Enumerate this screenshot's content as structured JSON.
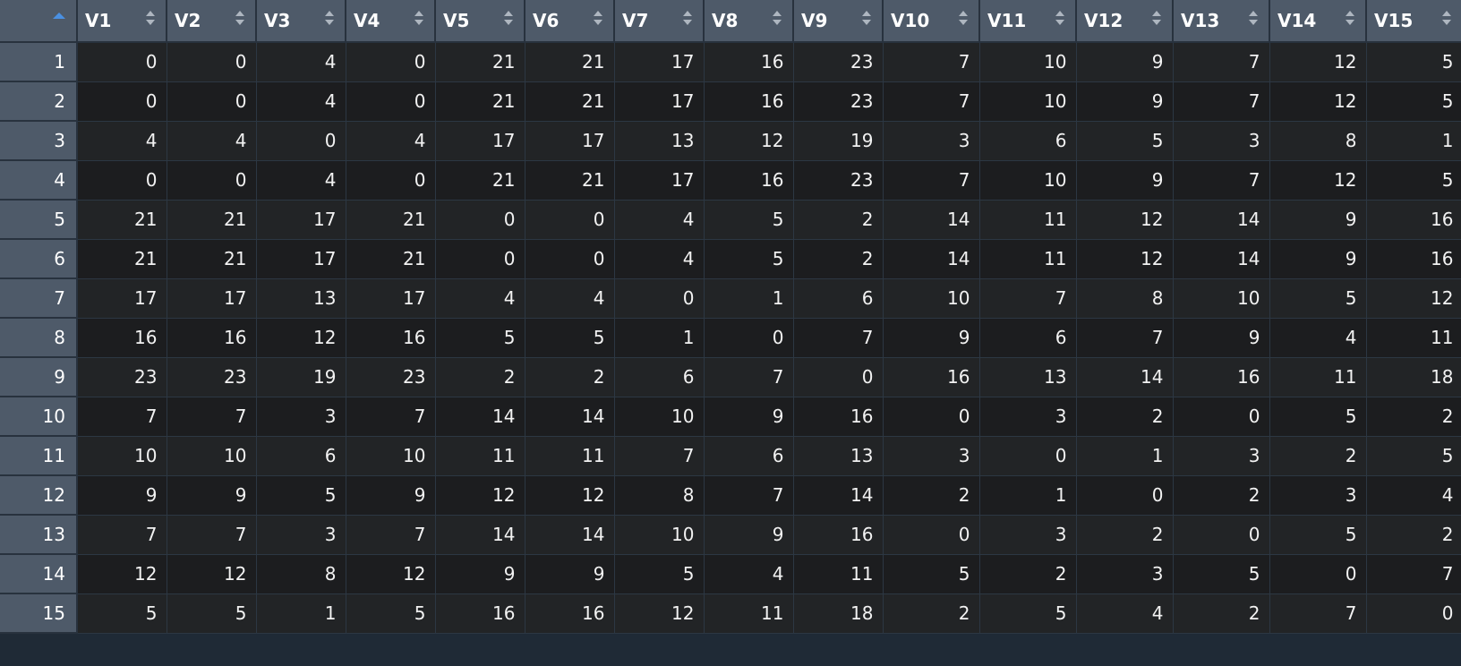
{
  "table": {
    "corner_label": "",
    "columns": [
      "V1",
      "V2",
      "V3",
      "V4",
      "V5",
      "V6",
      "V7",
      "V8",
      "V9",
      "V10",
      "V11",
      "V12",
      "V13",
      "V14",
      "V15"
    ],
    "row_names": [
      "1",
      "2",
      "3",
      "4",
      "5",
      "6",
      "7",
      "8",
      "9",
      "10",
      "11",
      "12",
      "13",
      "14",
      "15"
    ],
    "rows": [
      [
        0,
        0,
        4,
        0,
        21,
        21,
        17,
        16,
        23,
        7,
        10,
        9,
        7,
        12,
        5
      ],
      [
        0,
        0,
        4,
        0,
        21,
        21,
        17,
        16,
        23,
        7,
        10,
        9,
        7,
        12,
        5
      ],
      [
        4,
        4,
        0,
        4,
        17,
        17,
        13,
        12,
        19,
        3,
        6,
        5,
        3,
        8,
        1
      ],
      [
        0,
        0,
        4,
        0,
        21,
        21,
        17,
        16,
        23,
        7,
        10,
        9,
        7,
        12,
        5
      ],
      [
        21,
        21,
        17,
        21,
        0,
        0,
        4,
        5,
        2,
        14,
        11,
        12,
        14,
        9,
        16
      ],
      [
        21,
        21,
        17,
        21,
        0,
        0,
        4,
        5,
        2,
        14,
        11,
        12,
        14,
        9,
        16
      ],
      [
        17,
        17,
        13,
        17,
        4,
        4,
        0,
        1,
        6,
        10,
        7,
        8,
        10,
        5,
        12
      ],
      [
        16,
        16,
        12,
        16,
        5,
        5,
        1,
        0,
        7,
        9,
        6,
        7,
        9,
        4,
        11
      ],
      [
        23,
        23,
        19,
        23,
        2,
        2,
        6,
        7,
        0,
        16,
        13,
        14,
        16,
        11,
        18
      ],
      [
        7,
        7,
        3,
        7,
        14,
        14,
        10,
        9,
        16,
        0,
        3,
        2,
        0,
        5,
        2
      ],
      [
        10,
        10,
        6,
        10,
        11,
        11,
        7,
        6,
        13,
        3,
        0,
        1,
        3,
        2,
        5
      ],
      [
        9,
        9,
        5,
        9,
        12,
        12,
        8,
        7,
        14,
        2,
        1,
        0,
        2,
        3,
        4
      ],
      [
        7,
        7,
        3,
        7,
        14,
        14,
        10,
        9,
        16,
        0,
        3,
        2,
        0,
        5,
        2
      ],
      [
        12,
        12,
        8,
        12,
        9,
        9,
        5,
        4,
        11,
        5,
        2,
        3,
        5,
        0,
        7
      ],
      [
        5,
        5,
        1,
        5,
        16,
        16,
        12,
        11,
        18,
        2,
        5,
        4,
        2,
        7,
        0
      ]
    ],
    "sort_indicator": "sort-ascending-icon",
    "column_sort_icon": "sort-arrows-icon"
  },
  "colors": {
    "header_bg": "#4e5a69",
    "row_odd": "#222426",
    "row_even": "#1c1d1f",
    "accent": "#4a90e2"
  }
}
